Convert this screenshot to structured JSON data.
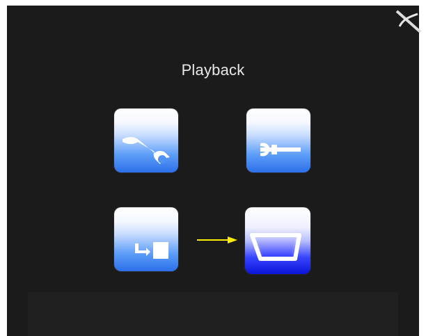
{
  "menu": {
    "title": "Playback",
    "icons": [
      {
        "name": "wrench-settings-icon"
      },
      {
        "name": "tool-connector-icon"
      },
      {
        "name": "copy-transfer-icon"
      },
      {
        "name": "display-screen-icon"
      }
    ],
    "selected_index": 3
  },
  "colors": {
    "screen_background": "#1b1b1b",
    "tile_blue": "#2c6fe8",
    "tile_selected_blue": "#0a14d8",
    "arrow": "#ffee00",
    "title_text": "#e8e8e8"
  },
  "pointer": {
    "icon": "arrow-right-icon"
  }
}
